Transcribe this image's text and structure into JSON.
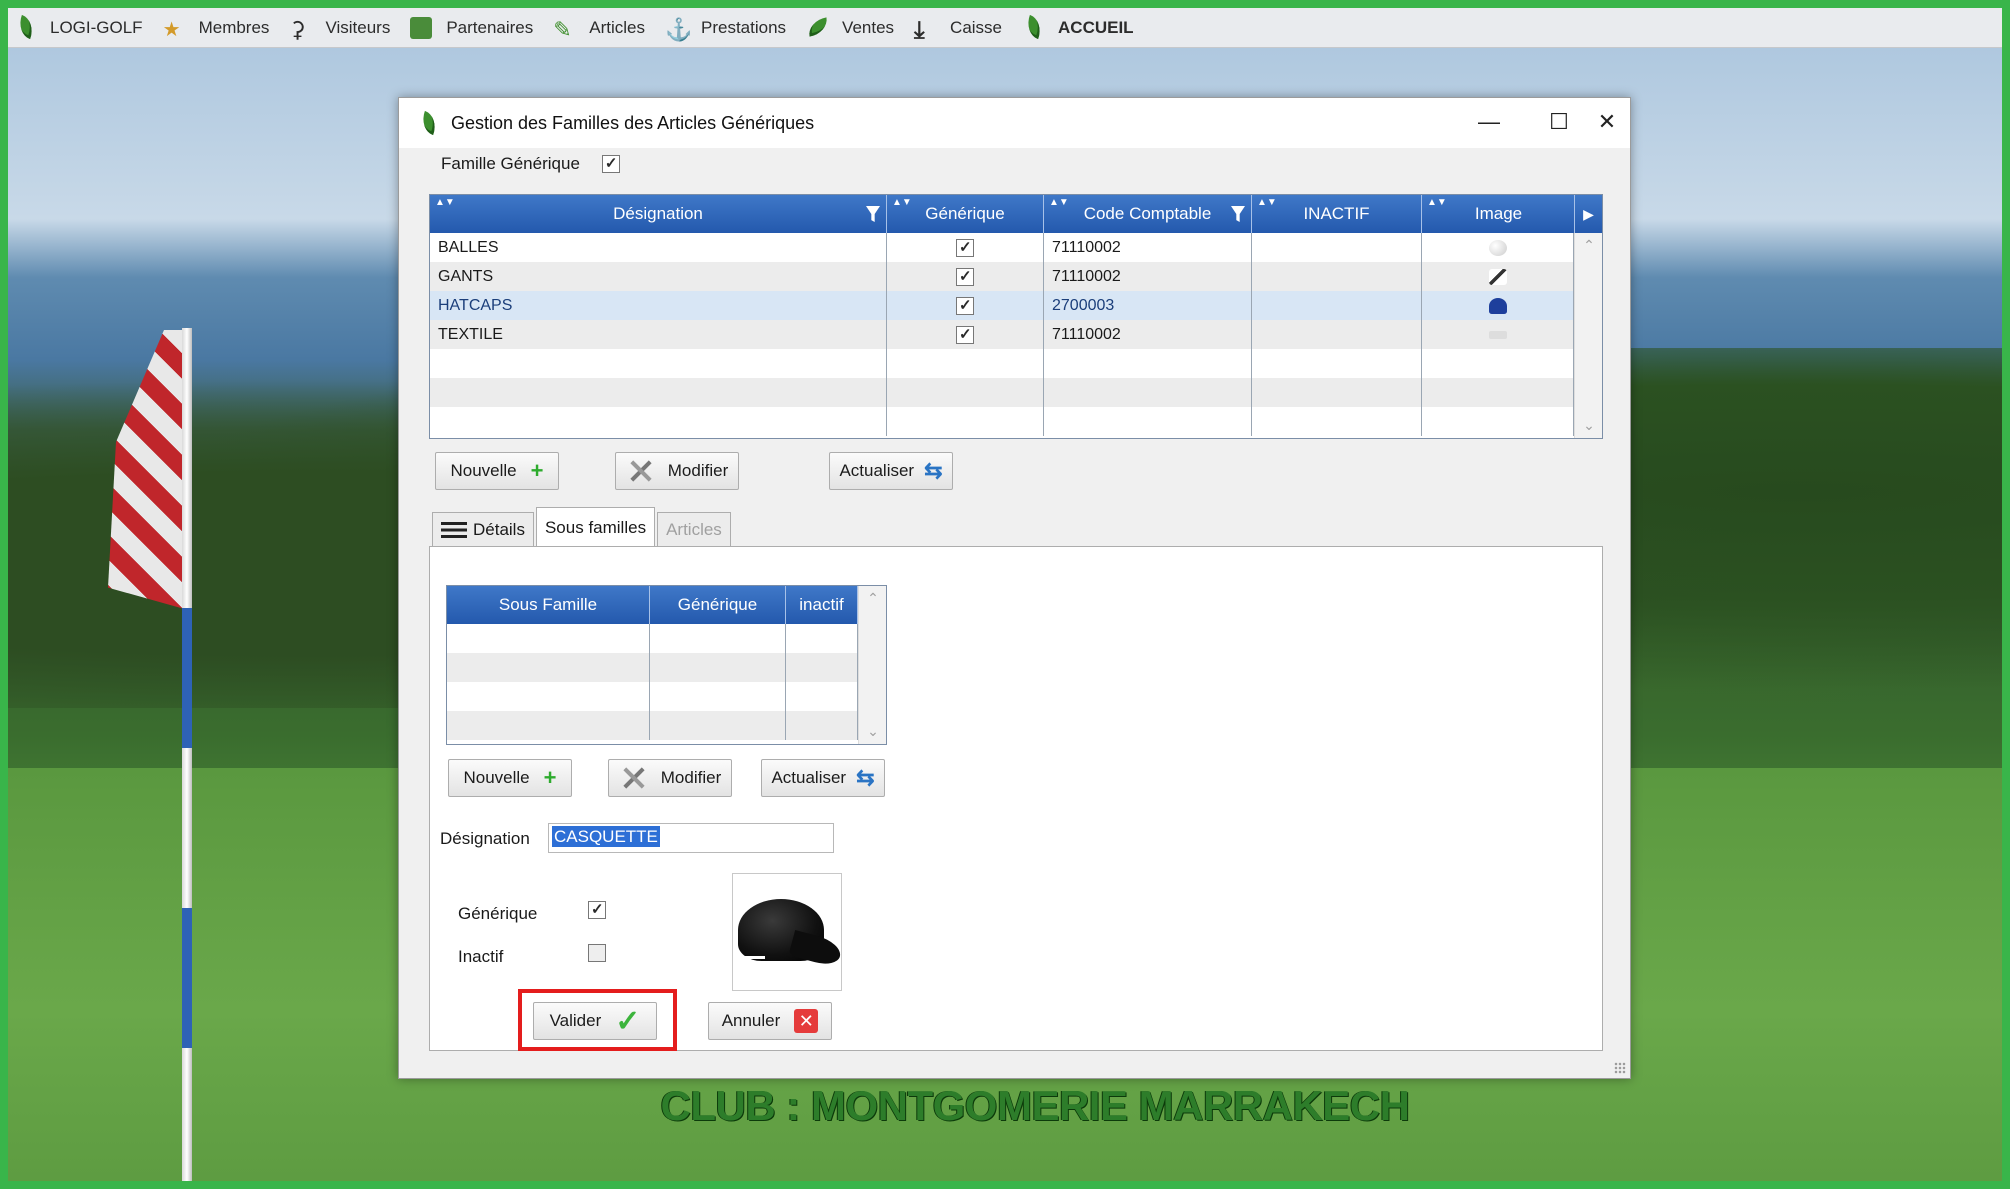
{
  "menu": {
    "items": [
      {
        "label": "LOGI-GOLF",
        "icon": "leaf-icon"
      },
      {
        "label": "Membres",
        "icon": "golfer-icon"
      },
      {
        "label": "Visiteurs",
        "icon": "walker-icon"
      },
      {
        "label": "Partenaires",
        "icon": "partners-icon"
      },
      {
        "label": "Articles",
        "icon": "pen-icon"
      },
      {
        "label": "Prestations",
        "icon": "swing-icon"
      },
      {
        "label": "Ventes",
        "icon": "shoe-icon"
      },
      {
        "label": "Caisse",
        "icon": "download-icon"
      },
      {
        "label": "ACCUEIL",
        "icon": "leaf-icon"
      }
    ]
  },
  "dialog": {
    "title": "Gestion des Familles des Articles Génériques",
    "window_controls": {
      "minimize": "—",
      "maximize": "☐",
      "close": "✕"
    },
    "famille_generique_label": "Famille Générique",
    "famille_generique_checked": true,
    "grid": {
      "columns": [
        "Désignation",
        "Générique",
        "Code Comptable",
        "INACTIF",
        "Image"
      ],
      "rows": [
        {
          "designation": "BALLES",
          "generique": true,
          "code": "71110002",
          "inactif": "",
          "image": "ball-thumb"
        },
        {
          "designation": "GANTS",
          "generique": true,
          "code": "71110002",
          "inactif": "",
          "image": "glove-thumb"
        },
        {
          "designation": "HATCAPS",
          "generique": true,
          "code": "2700003",
          "inactif": "",
          "image": "cap-thumb",
          "selected": true
        },
        {
          "designation": "TEXTILE",
          "generique": true,
          "code": "71110002",
          "inactif": "",
          "image": "textile-thumb"
        }
      ]
    },
    "buttons": {
      "nouvelle": "Nouvelle",
      "modifier": "Modifier",
      "actualiser": "Actualiser"
    },
    "tabs": [
      {
        "label": "Détails",
        "state": "normal"
      },
      {
        "label": "Sous familles",
        "state": "active"
      },
      {
        "label": "Articles",
        "state": "disabled"
      }
    ],
    "subgrid": {
      "columns": [
        "Sous Famille",
        "Générique",
        "inactif"
      ]
    },
    "sub_buttons": {
      "nouvelle": "Nouvelle",
      "modifier": "Modifier",
      "actualiser": "Actualiser"
    },
    "form": {
      "designation_label": "Désignation",
      "designation_value": "CASQUETTE",
      "generique_label": "Générique",
      "generique_checked": true,
      "inactif_label": "Inactif",
      "inactif_checked": false,
      "image": "black-cap-image"
    },
    "actions": {
      "valider": "Valider",
      "annuler": "Annuler"
    }
  },
  "footer": {
    "club": "CLUB : MONTGOMERIE MARRAKECH"
  },
  "colors": {
    "header_blue": "#2459ad",
    "frame_green": "#39b54a",
    "highlight_red": "#e41d1d"
  }
}
